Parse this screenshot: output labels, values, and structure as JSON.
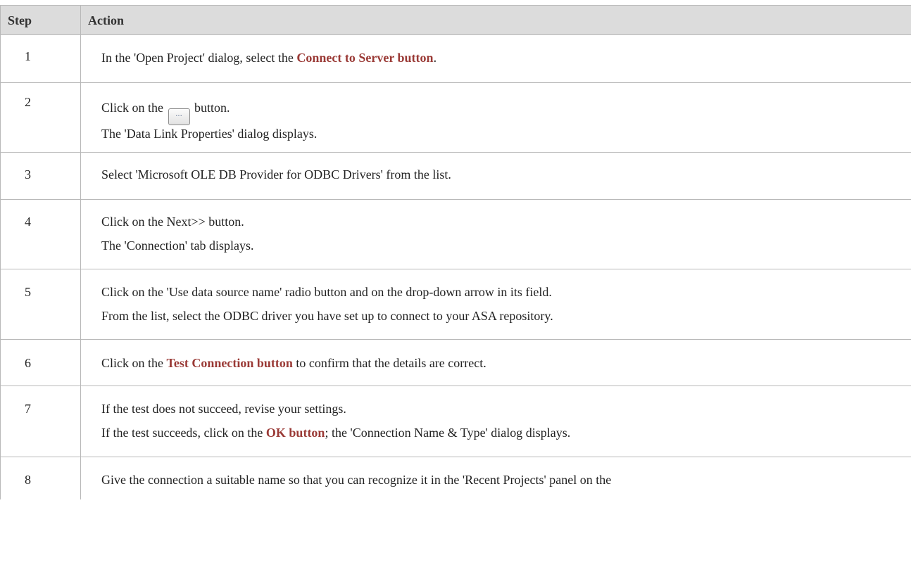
{
  "table": {
    "headers": [
      "Step",
      "Action"
    ],
    "rows": [
      {
        "step": "1",
        "lines": [
          {
            "a": "In the 'Open Project' dialog, select the ",
            "link": "Connect to Server button",
            "b": "."
          }
        ]
      },
      {
        "step": "2",
        "lines": [
          {
            "a": "Click on the ",
            "button": "...",
            "b": " button."
          },
          {
            "a": "The 'Data Link Properties' dialog displays."
          }
        ]
      },
      {
        "step": "3",
        "lines": [
          {
            "a": "Select 'Microsoft OLE DB Provider for ODBC Drivers' from the list."
          }
        ]
      },
      {
        "step": "4",
        "lines": [
          {
            "a": "Click on the Next>> button."
          },
          {
            "a": "The 'Connection' tab displays."
          }
        ]
      },
      {
        "step": "5",
        "lines": [
          {
            "a": "Click on the 'Use data source name' radio button and on the drop-down arrow in its field."
          },
          {
            "a": "From the list, select the ODBC driver you have set up to connect to your ASA repository."
          }
        ]
      },
      {
        "step": "6",
        "lines": [
          {
            "a": "Click on the ",
            "link": "Test Connection button",
            "b": " to confirm that the details are correct."
          }
        ]
      },
      {
        "step": "7",
        "lines": [
          {
            "a": "If the test does not succeed, revise your settings."
          },
          {
            "a": "If the test succeeds, click on the ",
            "link": "OK button",
            "b": "; the 'Connection Name & Type' dialog displays."
          }
        ]
      },
      {
        "step": "8",
        "lines": [
          {
            "a": "Give the connection a suitable name so that you can recognize it in the 'Recent Projects' panel on the"
          }
        ]
      }
    ]
  }
}
